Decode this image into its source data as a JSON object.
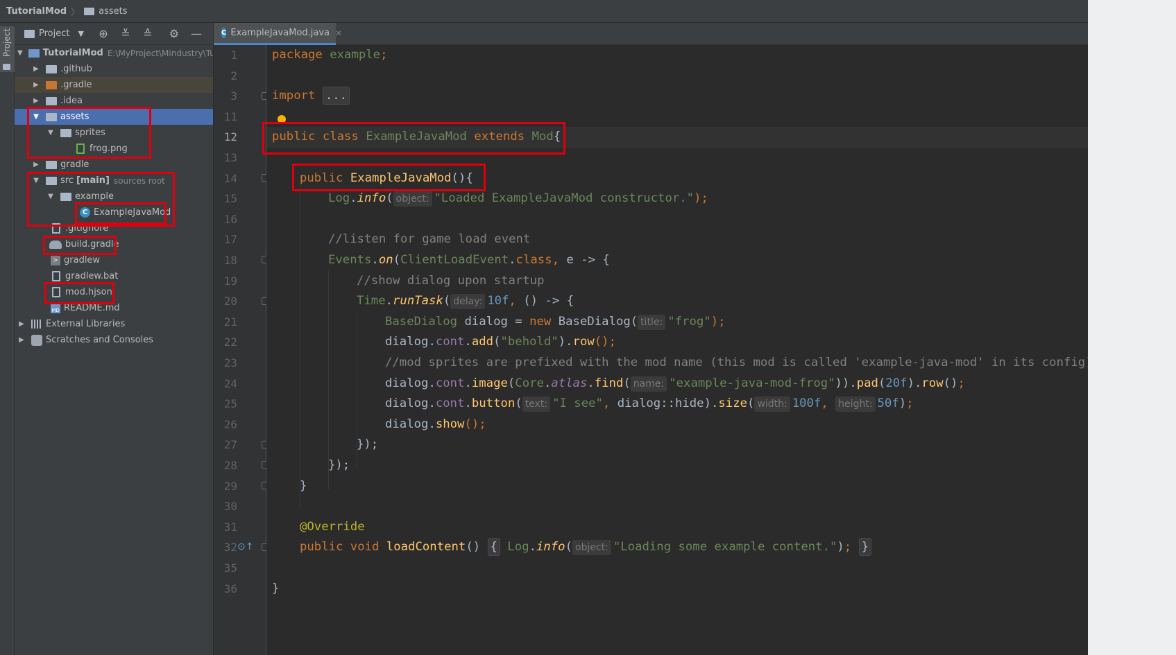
{
  "navbar": {
    "project": "TutorialMod",
    "folder": "assets"
  },
  "toolstrip": {
    "project_label": "Project"
  },
  "project_panel": {
    "title": "Project",
    "toolbar_icons": [
      "locate-icon",
      "expand-all-icon",
      "collapse-all-icon",
      "settings-icon",
      "hide-icon"
    ],
    "tree": [
      {
        "label": "TutorialMod",
        "note": "E:\\MyProject\\Mindustry\\Tu",
        "icon": "module-folder-icon",
        "expanded": true
      },
      {
        "label": ".github",
        "icon": "folder-icon",
        "expanded": false
      },
      {
        "label": ".gradle",
        "icon": "folder-icon",
        "expanded": false
      },
      {
        "label": ".idea",
        "icon": "folder-icon",
        "expanded": false
      },
      {
        "label": "assets",
        "icon": "folder-icon",
        "expanded": true,
        "selected": true
      },
      {
        "label": "sprites",
        "icon": "folder-icon",
        "expanded": true
      },
      {
        "label": "frog.png",
        "icon": "image-file-icon"
      },
      {
        "label": "gradle",
        "icon": "folder-icon",
        "expanded": false
      },
      {
        "label": "src",
        "bold": "[main]",
        "note": "sources root",
        "icon": "source-folder-icon",
        "expanded": true
      },
      {
        "label": "example",
        "icon": "package-icon",
        "expanded": true
      },
      {
        "label": "ExampleJavaMod",
        "icon": "java-class-icon"
      },
      {
        "label": ".gitignore",
        "icon": "file-icon"
      },
      {
        "label": "build.gradle",
        "icon": "gradle-icon"
      },
      {
        "label": "gradlew",
        "icon": "terminal-icon"
      },
      {
        "label": "gradlew.bat",
        "icon": "file-icon"
      },
      {
        "label": "mod.hjson",
        "icon": "file-icon"
      },
      {
        "label": "README.md",
        "icon": "markdown-icon"
      },
      {
        "label": "External Libraries",
        "icon": "libraries-icon",
        "expanded": false
      },
      {
        "label": "Scratches and Consoles",
        "icon": "scratches-icon",
        "expanded": false
      }
    ]
  },
  "editor": {
    "tab_label": "ExampleJavaMod.java",
    "line_numbers": [
      "1",
      "2",
      "3",
      "11",
      "12",
      "13",
      "14",
      "15",
      "16",
      "17",
      "18",
      "19",
      "20",
      "21",
      "22",
      "23",
      "24",
      "25",
      "26",
      "27",
      "28",
      "29",
      "30",
      "31",
      "32",
      "35",
      "36"
    ],
    "current_line": "12",
    "code": {
      "l1": {
        "kw": "package",
        "name": "example",
        "end": ";"
      },
      "l3": {
        "kw": "import",
        "fold": "..."
      },
      "l12": {
        "kw": "public class",
        "name": "ExampleJavaMod",
        "kw2": "extends",
        "base": "Mod",
        "end": "{"
      },
      "l14": {
        "kw": "public",
        "name": "ExampleJavaMod",
        "end": "(){"
      },
      "l15": {
        "cls": "Log",
        "method": "info",
        "hint": "object:",
        "str": "\"Loaded ExampleJavaMod constructor.\"",
        "end": ");"
      },
      "l17": {
        "comment": "//listen for game load event"
      },
      "l18": {
        "cls": "Events",
        "method": "on",
        "arg": "ClientLoadEvent",
        "kw": "class",
        "rest": " e -> {"
      },
      "l19": {
        "comment": "//show dialog upon startup"
      },
      "l20": {
        "cls": "Time",
        "method": "runTask",
        "hint": "delay:",
        "num": "10f",
        "rest": " () -> {"
      },
      "l21": {
        "type": "BaseDialog",
        "var": "dialog",
        "kw": "new",
        "ctor": "BaseDialog",
        "hint": "title:",
        "str": "\"frog\"",
        "end": ");"
      },
      "l22": {
        "obj": "dialog",
        "field": "cont",
        "method": "add",
        "str": "\"behold\"",
        "method2": "row",
        "end": "();"
      },
      "l23": {
        "comment": "//mod sprites are prefixed with the mod name (this mod is called 'example-java-mod' in its config)"
      },
      "l24": {
        "obj": "dialog",
        "field": "cont",
        "method": "image",
        "cls": "Core",
        "field2": "atlas",
        "method2": "find",
        "hint": "name:",
        "str": "\"example-java-mod-frog\"",
        "method3": "pad",
        "num": "20f",
        "method4": "row"
      },
      "l25": {
        "obj": "dialog",
        "field": "cont",
        "method": "button",
        "hint": "text:",
        "str": "\"I see\"",
        "ref": "dialog::hide",
        "method2": "size",
        "hint2": "width:",
        "num": "100f",
        "hint3": "height:",
        "num2": "50f"
      },
      "l26": {
        "obj": "dialog",
        "method": "show",
        "end": "();"
      },
      "l27": {
        "text": "});"
      },
      "l28": {
        "text": "});"
      },
      "l29": {
        "text": "}"
      },
      "l31": {
        "annotation": "@Override"
      },
      "l32": {
        "kw": "public void",
        "name": "loadContent",
        "cls": "Log",
        "method": "info",
        "hint": "object:",
        "str": "\"Loading some example content.\""
      },
      "l36": {
        "text": "}"
      }
    }
  },
  "colors": {
    "highlight_box": "#e0000d",
    "selection": "#4b6eaf",
    "keyword": "#cc7832",
    "string": "#6a8759",
    "number": "#6897bb",
    "method": "#ffc66d",
    "comment": "#808080"
  }
}
